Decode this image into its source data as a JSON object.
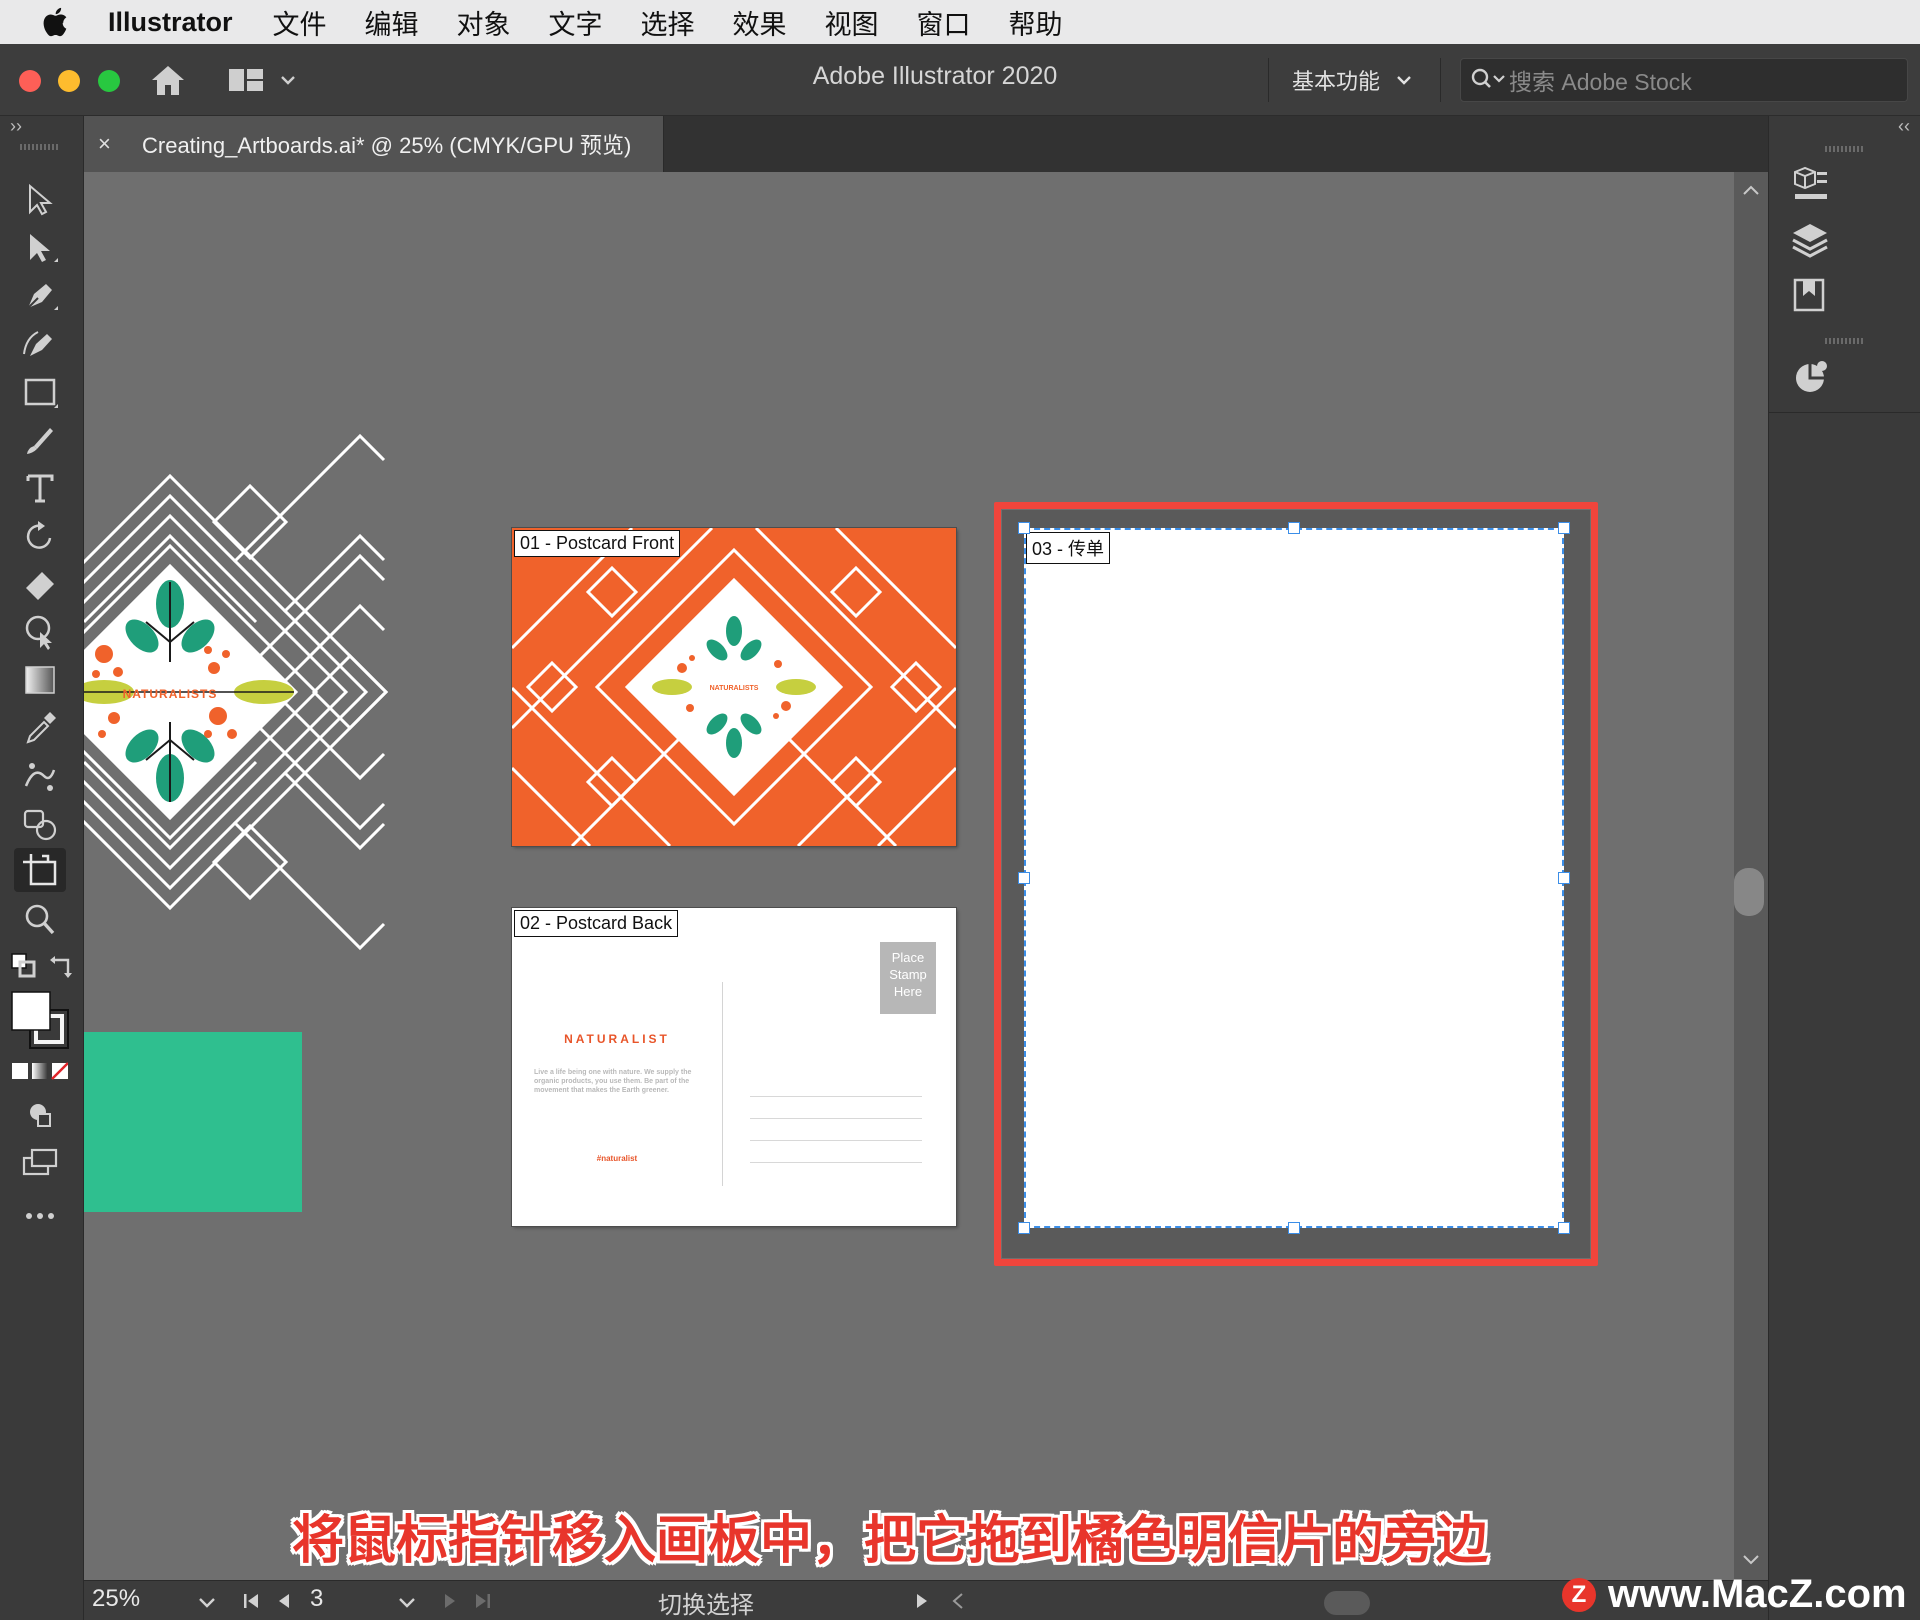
{
  "menubar": {
    "app_name": "Illustrator",
    "items": [
      "文件",
      "编辑",
      "对象",
      "文字",
      "选择",
      "效果",
      "视图",
      "窗口",
      "帮助"
    ]
  },
  "titlebar": {
    "title": "Adobe Illustrator 2020",
    "workspace": "基本功能",
    "search_placeholder": "搜索 Adobe Stock"
  },
  "document_tab": {
    "close": "×",
    "title": "Creating_Artboards.ai* @ 25% (CMYK/GPU 预览)"
  },
  "artboards": [
    {
      "label": "01 - Postcard Front"
    },
    {
      "label": "02 - Postcard Back"
    },
    {
      "label": "03 - 传单"
    }
  ],
  "artwork": {
    "brand": "NATURALISTS",
    "back_brand": "NATURALIST",
    "back_copy": "Live a life being one with nature. We supply the organic products, you use them. Be part of the movement that makes the Earth greener.",
    "back_hashtag": "#naturalist",
    "stamp": [
      "Place",
      "Stamp",
      "Here"
    ]
  },
  "statusbar": {
    "zoom": "25%",
    "artboard_number": "3",
    "mode": "切换选择"
  },
  "caption": "将鼠标指针移入画板中，把它拖到橘色明信片的旁边",
  "watermark": "www.MacZ.com",
  "watermark_logo": "Z",
  "colors": {
    "orange": "#f0622b",
    "green": "#2fbf8f",
    "leaf_green": "#1f9e7a",
    "lime": "#c6cf3f",
    "selection_blue": "#3b8ee8",
    "highlight_red": "#f0453c"
  }
}
